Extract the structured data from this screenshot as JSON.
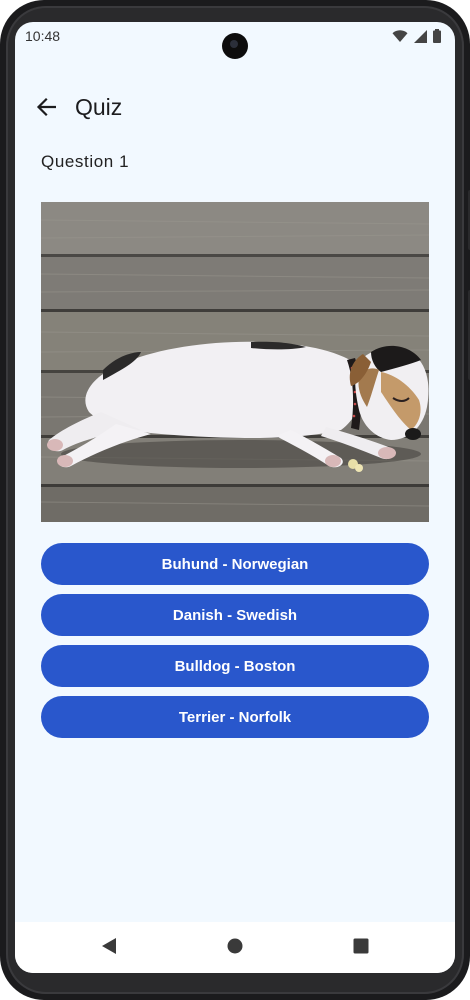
{
  "status_bar": {
    "time": "10:48",
    "icons": [
      "wifi-icon",
      "cellular-signal-icon",
      "battery-icon"
    ]
  },
  "app_bar": {
    "back_icon": "arrow-back-icon",
    "title": "Quiz"
  },
  "quiz": {
    "question_label": "Question 1",
    "image": {
      "subject": "dog-photo",
      "alt": ""
    },
    "answers": [
      {
        "label": "Buhund - Norwegian"
      },
      {
        "label": "Danish - Swedish"
      },
      {
        "label": "Bulldog - Boston"
      },
      {
        "label": "Terrier - Norfolk"
      }
    ]
  },
  "nav_bar": {
    "buttons": [
      "back-triangle-icon",
      "home-circle-icon",
      "recents-square-icon"
    ]
  },
  "colors": {
    "background": "#f2f9ff",
    "answer_button": "#2957cc",
    "answer_text": "#ffffff"
  }
}
